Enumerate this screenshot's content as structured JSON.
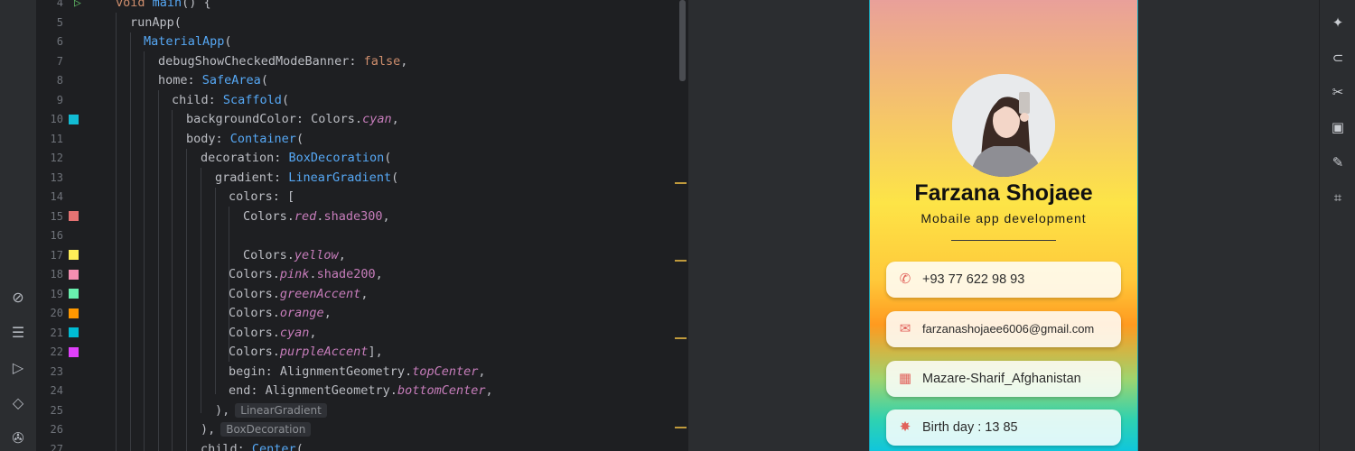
{
  "left_toolbar": {
    "icons": [
      "flutter-inspector-icon",
      "structure-icon",
      "run-icon",
      "gem-icon",
      "debug-icon"
    ]
  },
  "editor": {
    "line_numbers": [
      "4",
      "5",
      "6",
      "7",
      "8",
      "9",
      "10",
      "11",
      "12",
      "13",
      "14",
      "15",
      "16",
      "17",
      "18",
      "19",
      "20",
      "21",
      "22",
      "23",
      "24",
      "25",
      "26",
      "27"
    ],
    "swatch_colors": {
      "10": "#12bcd4",
      "15": "#e57373",
      "17": "#ffee58",
      "18": "#f48fb1",
      "19": "#69f0ae",
      "20": "#ff9800",
      "21": "#00bcd4",
      "22": "#e040fb"
    },
    "code": {
      "l4a": "void ",
      "l4b": "main",
      "l4c": "() {",
      "l5": "runApp(",
      "l6": "MaterialApp",
      "l6b": "(",
      "l7a": "debugShowCheckedModeBanner: ",
      "l7b": "false",
      "l7c": ",",
      "l8a": "home: ",
      "l8b": "SafeArea",
      "l8c": "(",
      "l9a": "child: ",
      "l9b": "Scaffold",
      "l9c": "(",
      "l10a": "backgroundColor: Colors.",
      "l10b": "cyan",
      "l10c": ",",
      "l11a": "body: ",
      "l11b": "Container",
      "l11c": "(",
      "l12a": "decoration: ",
      "l12b": "BoxDecoration",
      "l12c": "(",
      "l13a": "gradient: ",
      "l13b": "LinearGradient",
      "l13c": "(",
      "l14": "colors: [",
      "l15a": "Colors.",
      "l15b": "red",
      "l15c": ".",
      "l15d": "shade300",
      "l15e": ",",
      "l17a": "Colors.",
      "l17b": "yellow",
      "l17c": ",",
      "l18a": "Colors.",
      "l18b": "pink",
      "l18c": ".",
      "l18d": "shade200",
      "l18e": ",",
      "l19a": "Colors.",
      "l19b": "greenAccent",
      "l19c": ",",
      "l20a": "Colors.",
      "l20b": "orange",
      "l20c": ",",
      "l21a": "Colors.",
      "l21b": "cyan",
      "l21c": ",",
      "l22a": "Colors.",
      "l22b": "purpleAccent",
      "l22c": "],",
      "l23a": "begin: AlignmentGeometry.",
      "l23b": "topCenter",
      "l23c": ",",
      "l24a": "end: AlignmentGeometry.",
      "l24b": "bottomCenter",
      "l24c": ",",
      "l25a": "),",
      "l25hint": "LinearGradient",
      "l26a": "),",
      "l26hint": "BoxDecoration",
      "l27a": "child: ",
      "l27b": "Center",
      "l27c": "("
    }
  },
  "preview": {
    "name": "Farzana Shojaee",
    "subtitle": "Mobaile app development",
    "cards": [
      {
        "icon": "phone-icon",
        "glyph": "✆",
        "text": "+93 77 622 98 93"
      },
      {
        "icon": "email-icon",
        "glyph": "✉",
        "text": "farzanashojaee6006@gmail.com"
      },
      {
        "icon": "location-city-icon",
        "glyph": "▦",
        "text": "Mazare-Sharif_Afghanistan"
      },
      {
        "icon": "birthday-star-icon",
        "glyph": "✸",
        "text": "Birth day : 13 85"
      }
    ]
  },
  "right_toolbar": {
    "icons": [
      "ai-sparkle-icon",
      "link-icon",
      "scissors-icon",
      "image-edit-icon",
      "pencil-icon",
      "scan-icon"
    ]
  },
  "colors": {
    "editor_bg": "#1e1f22",
    "panel_bg": "#2b2d30",
    "accent_icon": "#e1625c"
  }
}
